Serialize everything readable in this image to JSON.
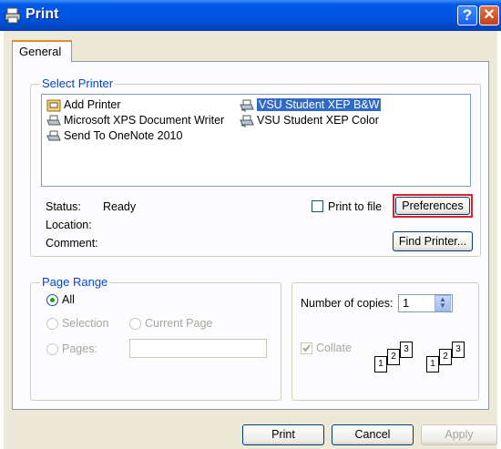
{
  "window": {
    "title": "Print",
    "help_label": "?",
    "close_label": "✕"
  },
  "tabs": [
    {
      "label": "General",
      "active": true
    }
  ],
  "select_printer": {
    "legend": "Select Printer",
    "printers": [
      {
        "name": "Add Printer",
        "icon": "add-printer-icon",
        "selected": false
      },
      {
        "name": "Microsoft XPS Document Writer",
        "icon": "printer-icon",
        "selected": false
      },
      {
        "name": "Send To OneNote 2010",
        "icon": "printer-icon",
        "selected": false
      },
      {
        "name": "VSU Student XEP B&W",
        "icon": "network-printer-icon",
        "selected": true
      },
      {
        "name": "VSU Student XEP Color",
        "icon": "network-printer-icon",
        "selected": false
      }
    ],
    "status_label": "Status:",
    "status_value": "Ready",
    "location_label": "Location:",
    "location_value": "",
    "comment_label": "Comment:",
    "comment_value": "",
    "print_to_file_label": "Print to file",
    "print_to_file_checked": false,
    "preferences_label": "Preferences",
    "find_printer_label": "Find Printer..."
  },
  "page_range": {
    "legend": "Page Range",
    "all_label": "All",
    "selection_label": "Selection",
    "current_page_label": "Current Page",
    "pages_label": "Pages:",
    "pages_value": "",
    "selected_option": "All"
  },
  "copies": {
    "number_label": "Number of copies:",
    "number_value": "1",
    "collate_label": "Collate",
    "collate_checked": true,
    "collate_pages": [
      "1",
      "2",
      "3",
      "1",
      "2",
      "3"
    ]
  },
  "footer": {
    "print_label": "Print",
    "cancel_label": "Cancel",
    "apply_label": "Apply"
  },
  "colors": {
    "titlebar": "#0054e3",
    "dialog_bg": "#ece9d8",
    "panel_bg": "#fcfcfe",
    "selection": "#316ac5",
    "group_legend": "#0046d5",
    "highlight_box": "#e0202a"
  }
}
